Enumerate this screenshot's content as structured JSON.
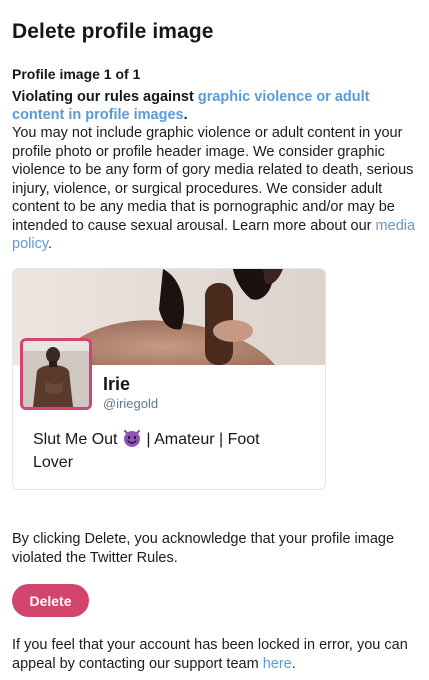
{
  "page": {
    "title": "Delete profile image",
    "count_label": "Profile image 1 of 1"
  },
  "rule": {
    "prefix": "Violating our rules against ",
    "link": "graphic violence or adult content in profile images",
    "suffix": "."
  },
  "description": {
    "text": "You may not include graphic violence or adult content in your profile photo or profile header image. We consider graphic violence to be any form of gory media related to death, serious injury, violence, or surgical procedures. We consider adult content to be any media that is pornographic and/or may be intended to cause sexual arousal. Learn more about our ",
    "link": "media policy",
    "suffix": "."
  },
  "profile": {
    "name": "Irie",
    "handle": "@iriegold",
    "bio_before": "Slut Me Out ",
    "bio_emoji": "smiling-imp-emoji",
    "bio_after": " | Amateur | Foot Lover"
  },
  "acknowledgement": "By clicking Delete, you acknowledge that your profile image violated the Twitter Rules.",
  "actions": {
    "delete_label": "Delete"
  },
  "appeal": {
    "text": "If you feel that your account has been locked in error, you can appeal by contacting our support team ",
    "link": "here",
    "suffix": "."
  },
  "colors": {
    "link": "#5b9bd5",
    "delete_button": "#d3456e",
    "avatar_border": "#d14670"
  }
}
